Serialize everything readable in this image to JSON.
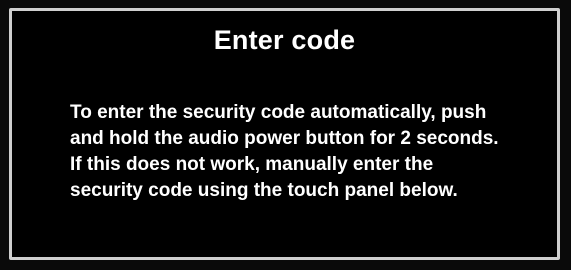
{
  "dialog": {
    "title": "Enter code",
    "message_lines": [
      "To enter the security code automatically, push",
      "and hold the audio power button for 2 seconds.",
      "If this does not work, manually enter the",
      "security code using the touch panel below."
    ]
  },
  "colors": {
    "background": "#000000",
    "border": "#cfcfcf",
    "text": "#ffffff"
  }
}
